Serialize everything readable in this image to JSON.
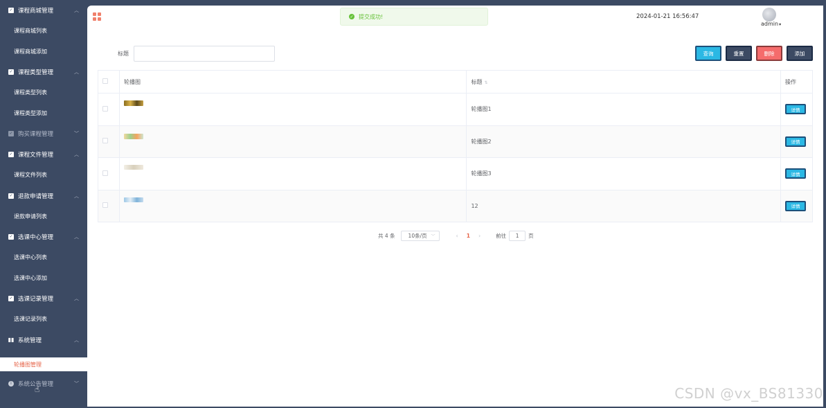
{
  "sidebar": {
    "groups": [
      {
        "label": "课程商城管理",
        "arrow": "^",
        "items": [
          "课程商城列表",
          "课程商城添加"
        ]
      },
      {
        "label": "课程类型管理",
        "arrow": "^",
        "items": [
          "课程类型列表",
          "课程类型添加"
        ]
      },
      {
        "label": "购买课程管理",
        "arrow": "v",
        "items": []
      },
      {
        "label": "课程文件管理",
        "arrow": "^",
        "items": [
          "课程文件列表"
        ]
      },
      {
        "label": "退款申请管理",
        "arrow": "^",
        "items": [
          "退款申请列表"
        ]
      },
      {
        "label": "选课中心管理",
        "arrow": "^",
        "items": [
          "选课中心列表",
          "选课中心添加"
        ]
      },
      {
        "label": "选课记录管理",
        "arrow": "^",
        "items": [
          "选课记录列表"
        ]
      },
      {
        "label": "系统管理",
        "arrow": "^",
        "items": []
      },
      {
        "label": "系统公告管理",
        "arrow": "v",
        "items": []
      }
    ],
    "active_item": "轮播图管理"
  },
  "header": {
    "toast": "提交成功!",
    "datetime": "2024-01-21 16:56:47",
    "username": "admin"
  },
  "search": {
    "label": "标题",
    "value": "",
    "buttons": {
      "query": "查询",
      "reset": "重置",
      "delete": "删除",
      "add": "添加"
    }
  },
  "table": {
    "columns": [
      "轮播图",
      "标题",
      "操作"
    ],
    "rows": [
      {
        "title": "轮播图1",
        "action": "详情"
      },
      {
        "title": "轮播图2",
        "action": "详情"
      },
      {
        "title": "轮播图3",
        "action": "详情"
      },
      {
        "title": "12",
        "action": "详情"
      }
    ]
  },
  "pagination": {
    "total": "共 4 条",
    "page_size": "10条/页",
    "current": "1",
    "goto_label": "前往",
    "goto_value": "1",
    "page_suffix": "页"
  },
  "watermark": "CSDN @vx_BS81330",
  "colors": {
    "sidebar_bg": "#3c4a63",
    "accent": "#e6654a",
    "primary_button": "#2bb8e4",
    "danger_button": "#f56c6c",
    "success": "#67c23a"
  }
}
